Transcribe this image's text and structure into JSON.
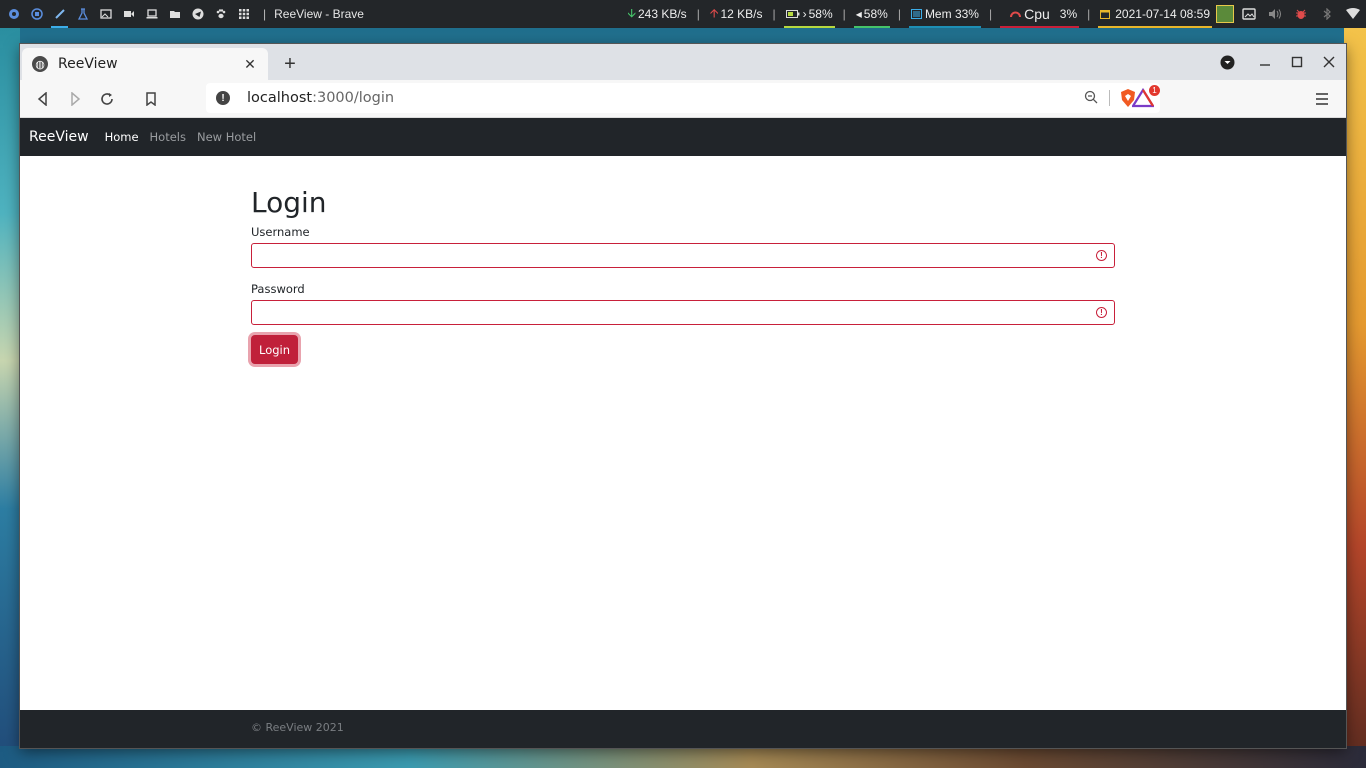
{
  "taskbar": {
    "window_title": "ReeView - Brave",
    "separator": "|",
    "launchers": [
      "debian-icon",
      "apps-icon",
      "color-picker-icon",
      "flask-icon",
      "image-viewer-icon",
      "video-camera-icon",
      "laptop-icon",
      "folder-icon",
      "telegram-icon",
      "paw-icon",
      "grid-icon"
    ],
    "net_down": "243 KB/s",
    "net_up": "12 KB/s",
    "battery": "58%",
    "volume": "58%",
    "mem": "Mem 33%",
    "cpu_label": "Cpu",
    "cpu_value": "3%",
    "datetime": "2021-07-14 08:59",
    "colors": {
      "accent": "#3daee9",
      "down": "#46c46a",
      "up": "#e04b4b",
      "cal": "#e8b62b"
    }
  },
  "browser": {
    "tab_title": "ReeView",
    "new_tab": "+",
    "close_tab": "✕",
    "url_host": "localhost",
    "url_path": ":3000/login",
    "rewards_badge": "1"
  },
  "app": {
    "brand": "ReeView",
    "nav": {
      "home": "Home",
      "hotels": "Hotels",
      "new_hotel": "New Hotel"
    },
    "heading": "Login",
    "username_label": "Username",
    "password_label": "Password",
    "login_button": "Login",
    "footer": "© ReeView 2021",
    "colors": {
      "navbar": "#212529",
      "invalid": "#c8203a",
      "button": "#c0203a"
    }
  }
}
